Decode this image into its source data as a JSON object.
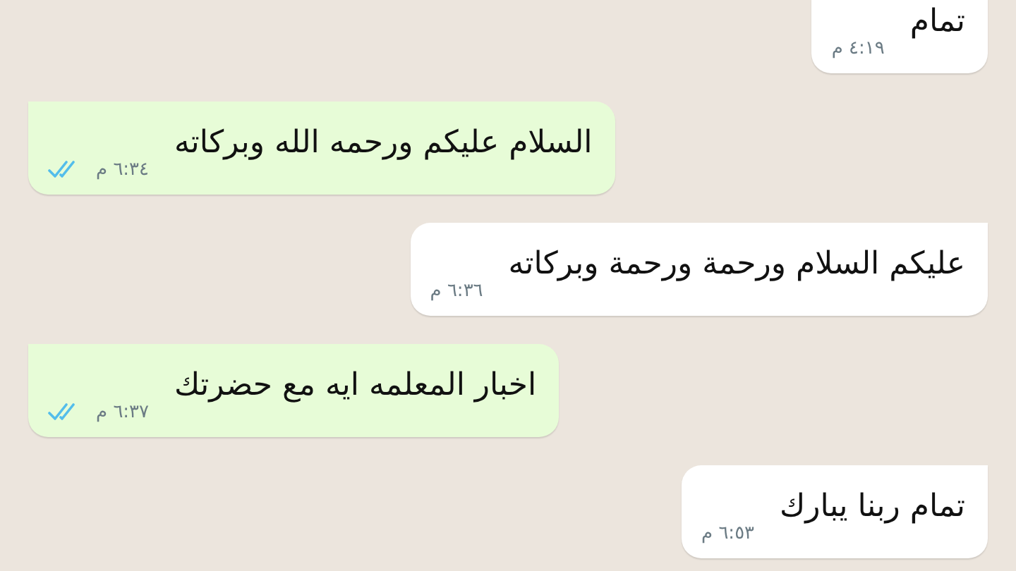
{
  "messages": [
    {
      "kind": "incoming",
      "text": "تمام",
      "time": "٤:١٩ م"
    },
    {
      "kind": "outgoing",
      "text": "السلام عليكم ورحمه الله وبركاته",
      "time": "٦:٣٤ م",
      "read": true
    },
    {
      "kind": "incoming",
      "text": "عليكم السلام ورحمة ورحمة وبركاته",
      "time": "٦:٣٦ م"
    },
    {
      "kind": "outgoing",
      "text": "اخبار المعلمه ايه مع حضرتك",
      "time": "٦:٣٧ م",
      "read": true
    },
    {
      "kind": "incoming",
      "text": "تمام ربنا يبارك",
      "time": "٦:٥٣ م"
    }
  ]
}
